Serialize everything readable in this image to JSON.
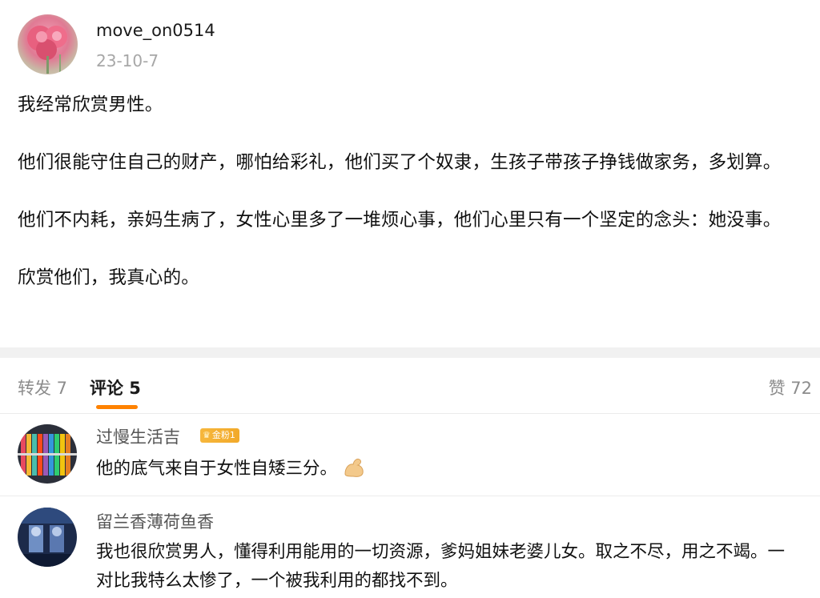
{
  "post": {
    "username": "move_on0514",
    "date": "23-10-7",
    "paragraphs": [
      "我经常欣赏男性。",
      "他们很能守住自己的财产，哪怕给彩礼，他们买了个奴隶，生孩子带孩子挣钱做家务，多划算。",
      "他们不内耗，亲妈生病了，女性心里多了一堆烦心事，他们心里只有一个坚定的念头：她没事。",
      "欣赏他们，我真心的。"
    ]
  },
  "tabs": {
    "repost": "转发 7",
    "comment": "评论 5",
    "like": "赞 72"
  },
  "comments": [
    {
      "name": "过慢生活吉",
      "badge": "金粉1",
      "text": "他的底气来自于女性自矮三分。",
      "emoji": "flexed-biceps-icon"
    },
    {
      "name": "留兰香薄荷鱼香",
      "text": "我也很欣赏男人，懂得利用能用的一切资源，爹妈姐妹老婆儿女。取之不尽，用之不竭。一对比我特么太惨了，一个被我利用的都找不到。"
    }
  ],
  "colors": {
    "accent": "#ff8200",
    "muted": "#8c8c8c",
    "badge": "#f6b73c"
  }
}
